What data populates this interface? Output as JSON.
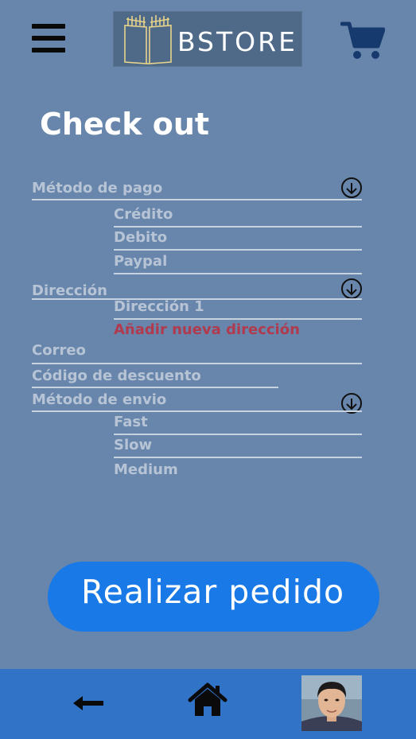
{
  "header": {
    "brand": "BSTORE",
    "menu_icon": "hamburger-menu-icon",
    "cart_icon": "shopping-cart-icon"
  },
  "page_title": "Check out",
  "form": {
    "payment": {
      "label": "Método de pago",
      "options": [
        "Crédito",
        "Debito",
        "Paypal"
      ]
    },
    "address": {
      "label": "Dirección",
      "options": [
        "Dirección 1"
      ],
      "add_new": "Añadir nueva dirección"
    },
    "email": {
      "label": "Correo"
    },
    "discount": {
      "label": "Código de descuento"
    },
    "shipping": {
      "label": "Método de envio",
      "options": [
        "Fast",
        "Slow",
        "Medium"
      ]
    }
  },
  "order_button": "Realizar pedido",
  "bottom_nav": {
    "back_icon": "back-arrow-icon",
    "home_icon": "home-icon",
    "profile_icon": "avatar"
  },
  "colors": {
    "background": "#6886ab",
    "button": "#1979e6",
    "bottom_bar": "#3173c6",
    "link_danger": "#b03a4e",
    "muted_text": "#b7c4d6"
  }
}
